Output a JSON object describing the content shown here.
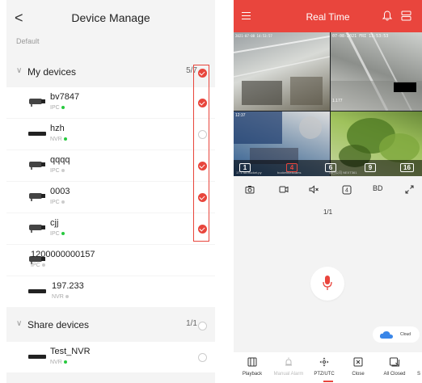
{
  "left": {
    "header": {
      "title": "Device Manage",
      "back": "<"
    },
    "default_label": "Default",
    "groups": [
      {
        "name": "My devices",
        "count": "5/7",
        "checked": true
      },
      {
        "name": "Share devices",
        "count": "1/1",
        "checked": false
      }
    ],
    "devices": [
      {
        "name": "bv7847",
        "type": "IPC",
        "status": "online",
        "checked": true,
        "icon": "bullet-camera-icon"
      },
      {
        "name": "hzh",
        "type": "NVR",
        "status": "online",
        "checked": false,
        "icon": "nvr-icon"
      },
      {
        "name": "qqqq",
        "type": "IPC",
        "status": "offline",
        "checked": true,
        "icon": "bullet-camera-icon"
      },
      {
        "name": "0003",
        "type": "IPC",
        "status": "offline",
        "checked": true,
        "icon": "bullet-camera-icon"
      },
      {
        "name": "cjj",
        "type": "IPC",
        "status": "online",
        "checked": true,
        "icon": "bullet-camera-icon"
      },
      {
        "name": "1200000000157",
        "type": "IPC",
        "status": "offline",
        "checked": false,
        "icon": "bullet-camera-icon"
      },
      {
        "name": "197.233",
        "type": "NVR",
        "status": "offline",
        "checked": false,
        "icon": "nvr-icon"
      }
    ],
    "share_devices": [
      {
        "name": "Test_NVR",
        "type": "NVR",
        "status": "online",
        "checked": false,
        "icon": "nvr-icon"
      }
    ],
    "colors": {
      "accent": "#e8453c",
      "online": "#27c93f",
      "offline": "#cccccc"
    }
  },
  "right": {
    "header": {
      "title": "Real Time"
    },
    "video": {
      "timestamp_1": "2021-07-08 14:53:57",
      "timestamp_2": "07-08-2021 FRI 13:53:53",
      "cam2_label": "1.177",
      "cam3_label": "12:37",
      "caption_1": "17.1.48.bucket.py",
      "caption_2": "bucketWebcams",
      "caption_3": "项目公司 NEXT361",
      "channels": [
        {
          "label": "1",
          "active": false
        },
        {
          "label": "4",
          "active": true
        },
        {
          "label": "6",
          "active": false
        },
        {
          "label": "9",
          "active": false
        },
        {
          "label": "16",
          "active": false
        }
      ]
    },
    "toolbar": {
      "quality": "BD"
    },
    "page_indicator": "1/1",
    "cloud_label": "Cloud",
    "bottom_nav": [
      {
        "label": "Playback",
        "icon": "playback-icon",
        "enabled": true
      },
      {
        "label": "Manual Alarm",
        "icon": "alarm-icon",
        "enabled": false
      },
      {
        "label": "PTZ/UTC",
        "icon": "ptz-icon",
        "enabled": true
      },
      {
        "label": "Close",
        "icon": "close-icon",
        "enabled": true
      },
      {
        "label": "All Closed",
        "icon": "all-closed-icon",
        "enabled": true
      },
      {
        "label": "S",
        "icon": "more-icon",
        "enabled": true
      }
    ],
    "colors": {
      "accent": "#e9453d"
    }
  }
}
